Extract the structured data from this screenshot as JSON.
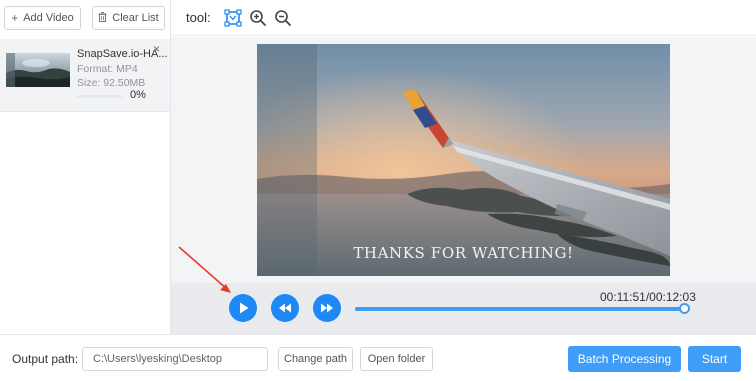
{
  "left_panel": {
    "add_video_label": "Add Video",
    "clear_list_label": "Clear List",
    "add_icon": "plus-icon",
    "clear_icon": "trash-icon",
    "file": {
      "name": "SnapSave.io-HA...",
      "format": "Format:  MP4",
      "size": "Size:  92.50MB",
      "progress_text": "0%",
      "progress": 0,
      "close_icon": "close-icon"
    }
  },
  "toolbar": {
    "label": "tool:",
    "icons": [
      "crop-icon",
      "zoom-in-icon",
      "zoom-out-icon"
    ],
    "accent": "#1e88f5"
  },
  "preview": {
    "caption": "THANKS FOR WATCHING!"
  },
  "player": {
    "time": "00:11:51/00:12:03",
    "progress": 0.985,
    "buttons": [
      "play-icon",
      "rewind-icon",
      "fast-forward-icon"
    ],
    "accent": "#1e88f5"
  },
  "bottom_bar": {
    "output_label": "Output path:",
    "output_value": "C:\\Users\\lyesking\\Desktop",
    "change_path_label": "Change path",
    "open_folder_label": "Open folder",
    "batch_label": "Batch Processing",
    "start_label": "Start",
    "primary_color": "#3f9cf7"
  },
  "annotation": {
    "arrow_color": "#e8392f"
  }
}
